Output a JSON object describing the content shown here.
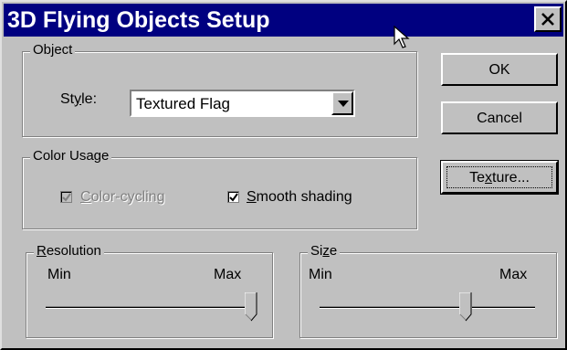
{
  "window": {
    "title": "3D Flying Objects Setup"
  },
  "object_group": {
    "legend": "Object",
    "style_label": "Style:",
    "style_value": "Textured Flag"
  },
  "color_group": {
    "legend": "Color Usage",
    "color_cycling": {
      "label": "Color-cycling",
      "checked": true,
      "enabled": false
    },
    "smooth_shading": {
      "label": "Smooth shading",
      "checked": true,
      "enabled": true
    }
  },
  "resolution_group": {
    "legend": "Resolution",
    "min_label": "Min",
    "max_label": "Max",
    "value_fraction": 1.0
  },
  "size_group": {
    "legend": "Size",
    "min_label": "Min",
    "max_label": "Max",
    "value_fraction": 0.69
  },
  "buttons": {
    "ok": "OK",
    "cancel": "Cancel",
    "texture": "Texture..."
  },
  "icons": [
    "close-icon",
    "dropdown-arrow-icon",
    "checkmark-icon",
    "mouse-cursor-icon"
  ]
}
